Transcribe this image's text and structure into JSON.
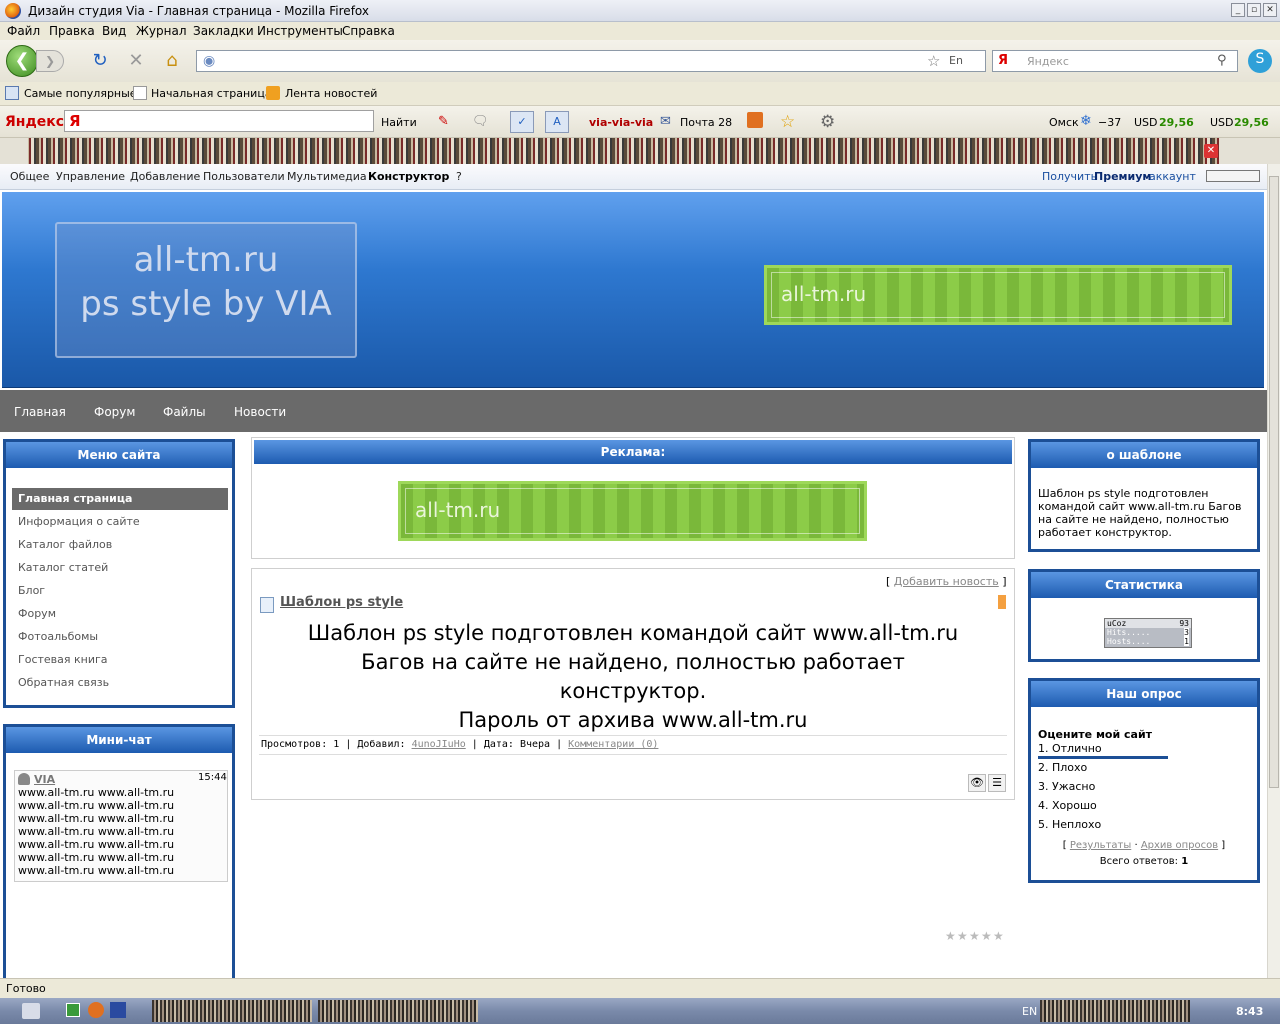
{
  "window": {
    "title": "Дизайн студия Via - Главная страница - Mozilla Firefox"
  },
  "menubar": [
    "Файл",
    "Правка",
    "Вид",
    "Журнал",
    "Закладки",
    "Инструменты",
    "Справка"
  ],
  "search": {
    "placeholder": "Яндекс"
  },
  "bookmarks": [
    "Самые популярные",
    "Начальная страница",
    "Лента новостей"
  ],
  "yandex_bar": {
    "logo": "Яндекс",
    "find": "Найти",
    "user": "via-via-via",
    "mail": "Почта 28",
    "city": "Омск",
    "temp": "−37",
    "usd1_label": "USD",
    "usd1_value": "29,56",
    "usd2_label": "USD",
    "usd2_value": "29,56"
  },
  "ucoz_panel": {
    "items": [
      "Общее",
      "Управление",
      "Добавление",
      "Пользователи",
      "Мультимедиа",
      "Конструктор",
      "?"
    ],
    "premium_pre": "Получить",
    "premium_strong": "Премиум",
    "premium_post": "аккаунт"
  },
  "header": {
    "logo_line1": "all-tm.ru",
    "logo_line2": "ps style by VIA",
    "banner_text": "all-tm.ru"
  },
  "topnav": [
    "Главная",
    "Форум",
    "Файлы",
    "Новости"
  ],
  "site_menu": {
    "title": "Меню сайта",
    "items": [
      "Главная страница",
      "Информация о сайте",
      "Каталог файлов",
      "Каталог статей",
      "Блог",
      "Форум",
      "Фотоальбомы",
      "Гостевая книга",
      "Обратная связь"
    ]
  },
  "minichat": {
    "title": "Мини-чат",
    "user": "VIA",
    "time": "15:44",
    "lines": [
      "www.all-tm.ru www.all-tm.ru",
      "www.all-tm.ru www.all-tm.ru",
      "www.all-tm.ru www.all-tm.ru",
      "www.all-tm.ru www.all-tm.ru",
      "www.all-tm.ru www.all-tm.ru",
      "www.all-tm.ru www.all-tm.ru",
      "www.all-tm.ru www.all-tm.ru"
    ]
  },
  "ad": {
    "title": "Реклама:",
    "banner_text": "all-tm.ru"
  },
  "news": {
    "add_link": "Добавить новость",
    "title": "Шаблон ps style",
    "body_lines": [
      "Шаблон ps style подготовлен командой сайт www.all-tm.ru",
      "Багов на сайте не найдено, полностью работает",
      "конструктор.",
      "Пароль от архива www.all-tm.ru"
    ],
    "views_label": "Просмотров:",
    "views": "1",
    "added_label": "Добавил:",
    "author": "4unoJIuHo",
    "date_label": "Дата:",
    "date": "Вчера",
    "comments": "Комментарии (0)"
  },
  "about": {
    "title": "о шаблоне",
    "lines": [
      "Шаблон ps style подготовлен",
      "командой сайт www.all-tm.ru Багов",
      "на сайте не найдено, полностью",
      "работает конструктор."
    ]
  },
  "stats": {
    "title": "Статистика",
    "counter_brand": "uCoz",
    "counter_total": "93",
    "hits_label": "Hits.....",
    "hits": "3",
    "hosts_label": "Hosts....",
    "hosts": "1"
  },
  "poll": {
    "title": "Наш опрос",
    "question": "Оцените мой сайт",
    "options": [
      "1. Отлично",
      "2. Плохо",
      "3. Ужасно",
      "4. Хорошо",
      "5. Неплохо"
    ],
    "leading_share": 1.0,
    "results": "Результаты",
    "archive": "Архив опросов",
    "total_label": "Всего ответов:",
    "total": "1"
  },
  "statusbar": {
    "text": "Готово"
  },
  "taskbar": {
    "lang": "EN",
    "clock": "8:43"
  },
  "colors": {
    "box_border": "#1c4f96",
    "box_header": "#1d5bb0",
    "nav_grey": "#6a6a6a",
    "usd_green": "#2a8a00",
    "banner_green": "#8ccc48"
  }
}
